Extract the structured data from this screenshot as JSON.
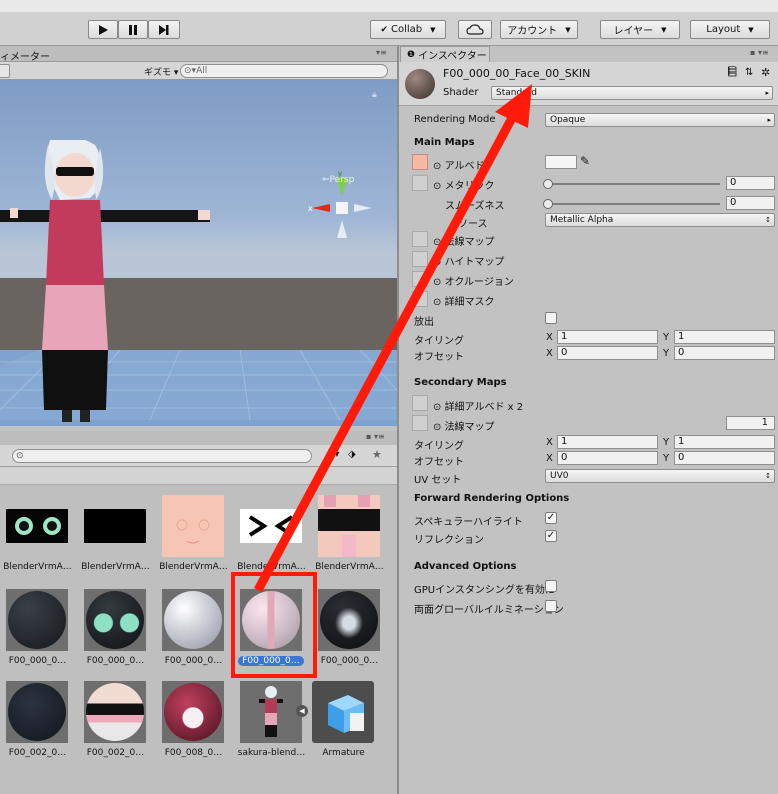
{
  "toolbar": {
    "collab_label": "Collab",
    "account_label": "アカウント",
    "layers_label": "レイヤー",
    "layout_label": "Layout"
  },
  "scene": {
    "tab_label": "ィメーター",
    "gizmos_label": "ギズモ",
    "search_placeholder": "All",
    "persp_label": "Persp"
  },
  "project": {
    "assets": [
      {
        "label": "BlenderVrmA…"
      },
      {
        "label": "BlenderVrmA…"
      },
      {
        "label": "BlenderVrmA…"
      },
      {
        "label": "BlenderVrmA…"
      },
      {
        "label": "BlenderVrmA…"
      },
      {
        "label": "F00_000_0…"
      },
      {
        "label": "F00_000_0…"
      },
      {
        "label": "F00_000_0…"
      },
      {
        "label": "F00_000_0…"
      },
      {
        "label": "F00_000_0…"
      },
      {
        "label": "F00_002_0…"
      },
      {
        "label": "F00_002_0…"
      },
      {
        "label": "F00_008_0…"
      },
      {
        "label": "sakura-blend…"
      },
      {
        "label": "Armature"
      }
    ]
  },
  "inspector": {
    "tab_label": "インスペクター",
    "material_name": "F00_000_00_Face_00_SKIN",
    "shader_label": "Shader",
    "shader_value": "Standard",
    "rendering_mode_label": "Rendering Mode",
    "rendering_mode_value": "Opaque",
    "main_maps_title": "Main Maps",
    "albedo_label": "アルベド",
    "metallic_label": "メタリック",
    "metallic_value": "0",
    "smoothness_label": "スムーズネス",
    "smoothness_value": "0",
    "source_label": "ソース",
    "source_value": "Metallic Alpha",
    "normal_map_label": "法線マップ",
    "height_map_label": "ハイトマップ",
    "occlusion_label": "オクルージョン",
    "detail_mask_label": "詳細マスク",
    "emission_label": "放出",
    "tiling_label": "タイリング",
    "offset_label": "オフセット",
    "x_label": "X",
    "y_label": "Y",
    "main_tiling_x": "1",
    "main_tiling_y": "1",
    "main_offset_x": "0",
    "main_offset_y": "0",
    "secondary_maps_title": "Secondary Maps",
    "detail_albedo_label": "詳細アルベド x 2",
    "sec_normal_label": "法線マップ",
    "sec_normal_value": "1",
    "sec_tiling_x": "1",
    "sec_tiling_y": "1",
    "sec_offset_x": "0",
    "sec_offset_y": "0",
    "uv_set_label": "UV セット",
    "uv_set_value": "UV0",
    "forward_title": "Forward Rendering Options",
    "specular_label": "スペキュラーハイライト",
    "reflection_label": "リフレクション",
    "advanced_title": "Advanced Options",
    "gpu_label": "GPUインスタンシングを有効に",
    "double_gi_label": "両面グローバルイルミネーション"
  },
  "colors": {
    "arrow": "#ff0000",
    "selection": "#3a76d4",
    "highlight_box": "#ff0000"
  }
}
